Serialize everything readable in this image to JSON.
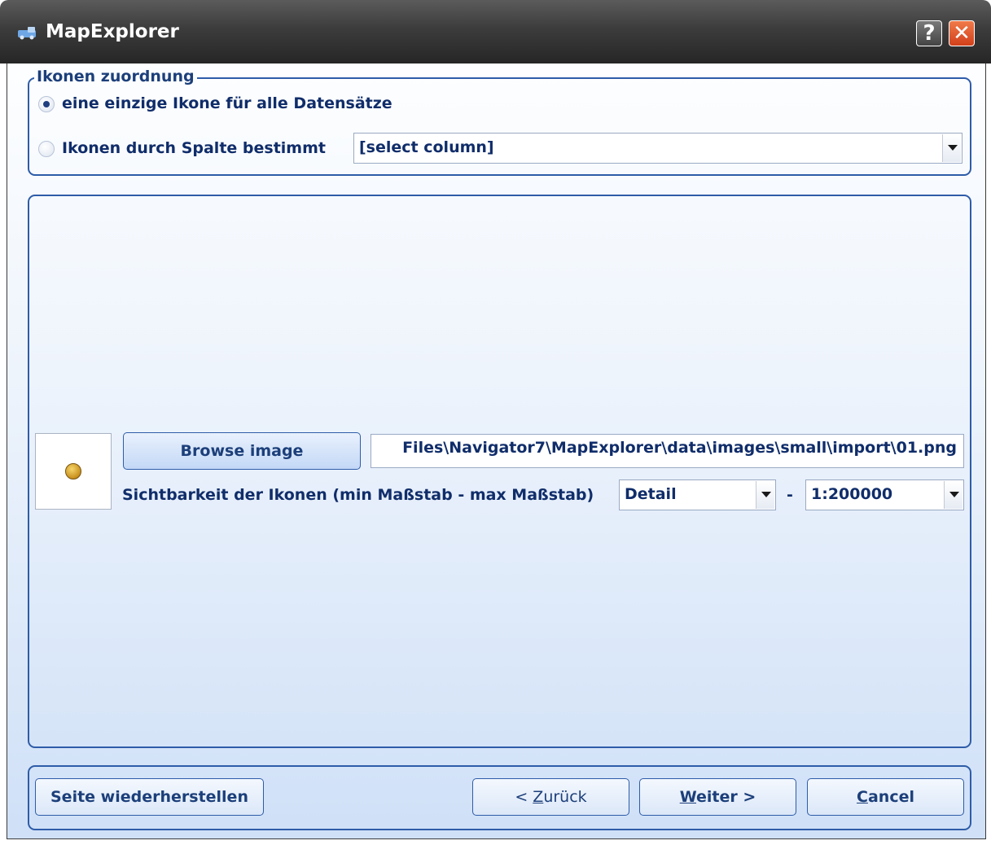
{
  "window": {
    "title": "MapExplorer",
    "help_label": "?",
    "close_label": "✕"
  },
  "icon_assignment": {
    "legend": "Ikonen zuordnung",
    "option_single": "eine einzige Ikone für alle Datensätze",
    "option_by_column": "Ikonen durch Spalte bestimmt",
    "selected_option": "option_single",
    "column_select_value": "[select column]"
  },
  "icon_settings": {
    "browse_label": "Browse image",
    "image_path": "Files\\Navigator7\\MapExplorer\\data\\images\\small\\import\\01.png",
    "visibility_label": "Sichtbarkeit der Ikonen (min Maßstab - max Maßstab)",
    "min_scale": "Detail",
    "range_separator": "-",
    "max_scale": "1:200000"
  },
  "footer": {
    "restore_label": "Seite wiederherstellen",
    "back_prefix": "< ",
    "back_accel": "Z",
    "back_rest": "urück",
    "next_accel": "W",
    "next_rest": "eiter >",
    "cancel_accel": "C",
    "cancel_rest": "ancel"
  }
}
